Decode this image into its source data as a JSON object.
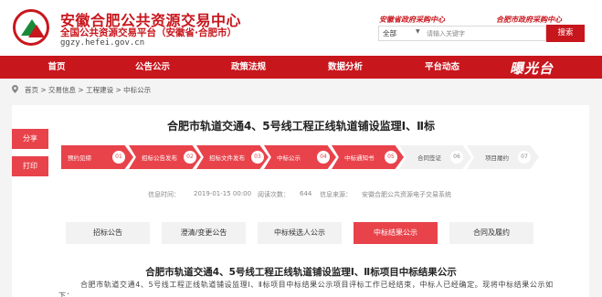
{
  "header": {
    "title": "安徽合肥公共资源交易中心",
    "subtitle": "全国公共资源交易平台（安徽省·合肥市）",
    "url": "ggzy.hefei.gov.cn",
    "top_links": [
      "安徽省政府采购中心",
      "合肥市政府采购中心"
    ],
    "search": {
      "category": "全部",
      "placeholder": "请输入关键字",
      "button_label": "搜索"
    }
  },
  "nav": {
    "items": [
      "首页",
      "公告公示",
      "政策法规",
      "数据分析",
      "平台动态"
    ],
    "brand": "曝光台"
  },
  "breadcrumb": {
    "text": "首页 > 交易信息 > 工程建设 > 中标公示"
  },
  "sidebar": {
    "share_label": "分享",
    "print_label": "打印"
  },
  "article": {
    "title": "合肥市轨道交通4、5号线工程正线轨道铺设监理Ⅰ、Ⅱ标",
    "steps": [
      {
        "label": "预约见缔",
        "num": "01",
        "active": true
      },
      {
        "label": "招标公告发布",
        "num": "02",
        "active": true
      },
      {
        "label": "招标文件发布",
        "num": "03",
        "active": true
      },
      {
        "label": "中标公示",
        "num": "04",
        "active": true
      },
      {
        "label": "中标通知书",
        "num": "05",
        "active": true
      },
      {
        "label": "合同签证",
        "num": "06",
        "active": false
      },
      {
        "label": "项目履约",
        "num": "07",
        "active": false
      }
    ],
    "info": {
      "time_label": "信息时间：",
      "time_value": "2019-01-15 00:00",
      "views_label": "阅读次数：",
      "views_value": "644",
      "source_label": "信息来源：",
      "source_value": "安徽合肥公共资源电子交易系统"
    },
    "tabs": [
      {
        "label": "招标公告",
        "active": false
      },
      {
        "label": "澄清/变更公告",
        "active": false
      },
      {
        "label": "中标候选人公示",
        "active": false
      },
      {
        "label": "中标结果公示",
        "active": true
      },
      {
        "label": "合同及履约",
        "active": false
      }
    ],
    "content_title": "合肥市轨道交通4、5号线工程正线轨道铺设监理Ⅰ、Ⅱ标项目中标结果公示",
    "content_body": "合肥市轨道交通4、5号线工程正线轨道铺设监理Ⅰ、Ⅱ标项目中标结果公示项目评标工作已经结束，中标人已经确定。现将中标结果公示如下："
  },
  "colors": {
    "brand_red": "#c8161d",
    "accent_red": "#e8434b",
    "inactive_gray": "#f1f1f1"
  }
}
